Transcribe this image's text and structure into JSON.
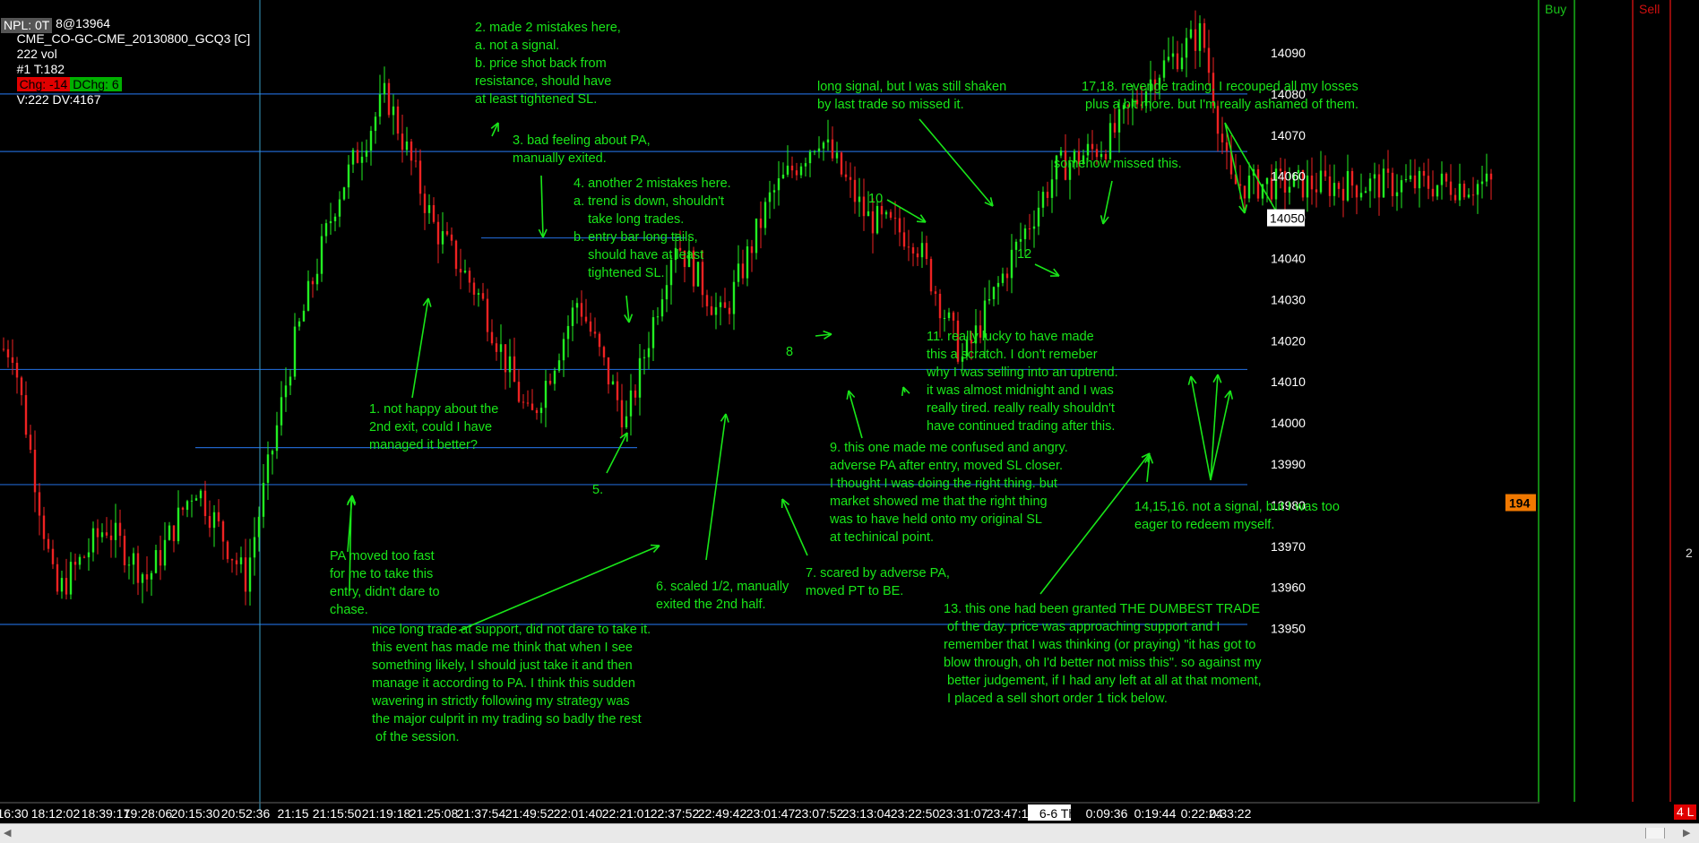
{
  "header": {
    "trade_label": "Trade: 8@13964",
    "symbol": "CME_CO-GC-CME_20130800_GCQ3 [C]",
    "volume": "222 vol",
    "trade_count": "#1 T:182",
    "chg": "Chg: -14",
    "dchg": "DChg: 6",
    "v_dv": "V:222 DV:4167",
    "npl": "NPL: 0T"
  },
  "panels": {
    "buy_label": "Buy",
    "sell_label": "Sell",
    "sell_side_value": "2",
    "corner_badge": "4 L"
  },
  "price_axis": {
    "ticks": [
      "14090",
      "14080",
      "14070",
      "14060",
      "14050",
      "14040",
      "14030",
      "14020",
      "14010",
      "14000",
      "13990",
      "13980",
      "13970",
      "13960",
      "13950"
    ],
    "current_price": "14050",
    "marker_value": "194"
  },
  "time_axis": {
    "labels": [
      "16:30",
      "18:12:02",
      "18:39:17",
      "19:28:06",
      "20:15:30",
      "20:52:36",
      "21:15",
      "21:15:50",
      "21:19:18",
      "21:25:08",
      "21:37:54",
      "21:49:52",
      "22:01:40",
      "22:21:01",
      "22:37:52",
      "22:49:42",
      "23:01:47",
      "23:07:52",
      "23:13:04",
      "23:22:50",
      "23:31:07",
      "23:47:15",
      "6-6 Th",
      "0:09:36",
      "0:19:44",
      "0:22:24",
      "0:33:22"
    ]
  },
  "annotations": {
    "a1": "1. not happy about the\n2nd exit, could I have\nmanaged it better?",
    "a2": "2. made 2 mistakes here,\na. not a signal.\nb. price shot back from\nresistance, should have\nat least tightened SL.",
    "a3": "3. bad feeling about PA,\nmanually exited.",
    "a4": "4. another 2 mistakes here.\na. trend is down, shouldn't\n    take long trades.\nb. entry bar long tails,\n    should have at least\n    tightened SL.",
    "a5": "5.",
    "a6": "6. scaled 1/2, manually\nexited the 2nd half.",
    "a7": "7. scared by adverse PA,\nmoved PT to BE.",
    "a8": "8",
    "a9": "9. this one made me confused and angry.\nadverse PA after entry, moved SL closer.\nI thought I was doing the right thing. but\nmarket showed me that the right thing\nwas to have held onto my original SL\nat techinical point.",
    "a10": "10",
    "a11": "11. really lucky to have made\nthis a scratch. I don't remeber\nwhy I was selling into an uptrend.\nit was almost midnight and I was\nreally tired. really really shouldn't\nhave continued trading after this.",
    "a12": "12",
    "a13": "13. this one had been granted THE DUMBEST TRADE\n of the day. price was approaching support and I\nremember that I was thinking (or praying) \"it has got to\nblow through, oh I'd better not miss this\". so against my\n better judgement, if I had any left at all at that moment,\n I placed a sell short order 1 tick below.",
    "a14": "14,15,16. not a signal, but I was too\neager to redeem myself.",
    "a17": "17,18. revenge trading. I recouped all my losses\n plus a bit more. but I'm really ashamed of them.",
    "long_missed": "long signal, but I was still shaken\nby last trade so missed it.",
    "somehow": "somehow missed this.",
    "pa_fast": "PA moved too fast\nfor me to take this\nentry, didn't dare to\nchase.",
    "support": "nice long trade at support, did not dare to take it.\nthis event has made me think that when I see\nsomething likely, I should just take it and then\nmanage it according to PA. I think this sudden\nwavering in strictly following my strategy was\nthe major culprit in my trading so badly the rest\n of the session."
  },
  "colors": {
    "background": "#000000",
    "annotation": "#19e619",
    "bull_bar": "#22ee22",
    "bear_bar": "#ee2222",
    "level_line": "#1f63c8",
    "chg_box": "#e00000",
    "dchg_box": "#00b000",
    "marker_box": "#f07800",
    "badge_box": "#e00000"
  },
  "chart_data": {
    "type": "bar",
    "title": "",
    "symbol": "CME_CO-GC-CME_20130800_GCQ3",
    "ylim": [
      13942,
      14100
    ],
    "horizontal_levels": [
      14080,
      14066,
      14013,
      13985,
      13951
    ],
    "short_levels": [
      {
        "price": 14045,
        "from": "21:37:54",
        "to": "22:37:52"
      },
      {
        "price": 13994,
        "from": "20:15:30",
        "to": "22:21:01"
      }
    ],
    "vertical_time_marker": "20:52:36",
    "grid": false,
    "ohlc_anchors": [
      {
        "t": "16:30",
        "price": 14018
      },
      {
        "t": "18:12:02",
        "price": 13958
      },
      {
        "t": "18:39:17",
        "price": 13975
      },
      {
        "t": "19:28:06",
        "price": 13962
      },
      {
        "t": "20:15:30",
        "price": 13985
      },
      {
        "t": "20:52:36",
        "price": 13962
      },
      {
        "t": "21:15",
        "price": 14018
      },
      {
        "t": "21:15:50",
        "price": 14055
      },
      {
        "t": "21:19:18",
        "price": 14080
      },
      {
        "t": "21:25:08",
        "price": 14048
      },
      {
        "t": "21:37:54",
        "price": 14030
      },
      {
        "t": "21:49:52",
        "price": 14000
      },
      {
        "t": "22:01:40",
        "price": 14030
      },
      {
        "t": "22:21:01",
        "price": 14000
      },
      {
        "t": "22:37:52",
        "price": 14045
      },
      {
        "t": "22:49:42",
        "price": 14025
      },
      {
        "t": "23:01:47",
        "price": 14055
      },
      {
        "t": "23:07:52",
        "price": 14070
      },
      {
        "t": "23:13:04",
        "price": 14050
      },
      {
        "t": "23:22:50",
        "price": 14045
      },
      {
        "t": "23:31:07",
        "price": 14015
      },
      {
        "t": "23:47:15",
        "price": 14040
      },
      {
        "t": "6-6 Th",
        "price": 14062
      },
      {
        "t": "0:09:36",
        "price": 14068
      },
      {
        "t": "0:19:44",
        "price": 14085
      },
      {
        "t": "0:22:24",
        "price": 14095
      },
      {
        "t": "0:33:22",
        "price": 14058
      }
    ]
  }
}
